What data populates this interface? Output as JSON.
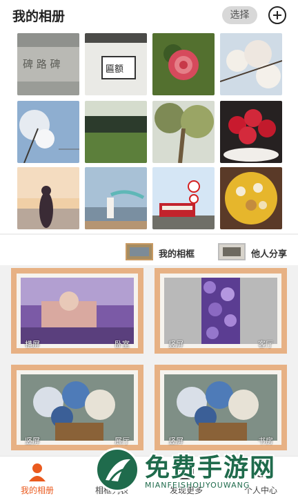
{
  "header": {
    "title": "我的相册",
    "select_label": "选择"
  },
  "photos": [
    {
      "name": "stone-inscription-photo"
    },
    {
      "name": "wall-plaque-photo"
    },
    {
      "name": "camellia-flower-photo"
    },
    {
      "name": "blossom-branches-photo"
    },
    {
      "name": "blossom-tree-sky-photo"
    },
    {
      "name": "green-meadow-photo"
    },
    {
      "name": "tree-upward-photo"
    },
    {
      "name": "raspberries-bowl-photo"
    },
    {
      "name": "woman-sunset-beach-photo"
    },
    {
      "name": "woman-scarf-beach-photo"
    },
    {
      "name": "red-tram-photo"
    },
    {
      "name": "fruit-platter-photo"
    }
  ],
  "frame_tabs": {
    "mine": "我的相框",
    "shared": "他人分享"
  },
  "frames": [
    {
      "orientation": "横屏",
      "room": "卧室"
    },
    {
      "orientation": "竖屏",
      "room": "客厅"
    },
    {
      "orientation": "竖屏",
      "room": "展厅"
    },
    {
      "orientation": "竖屏",
      "room": "书房"
    }
  ],
  "tabbar": {
    "tabs": [
      {
        "label": "我的相册",
        "active": true
      },
      {
        "label": "相框列表"
      },
      {
        "label": "发现更多"
      },
      {
        "label": "个人中心"
      }
    ]
  },
  "watermark": {
    "text": "免费手游网",
    "sub": "MIANFEISHOUYOUWANG"
  },
  "colors": {
    "accent": "#ea5a1e",
    "frame_wood": "#e7b184"
  }
}
